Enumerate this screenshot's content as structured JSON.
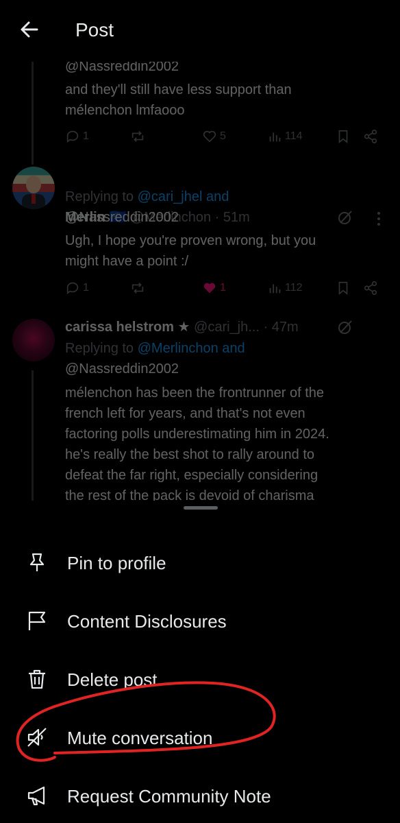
{
  "header": {
    "title": "Post"
  },
  "tweets": [
    {
      "replying_handle_cont": "@Nassreddin2002",
      "text_lines": [
        "and they'll still have less support than",
        "mélenchon lmfaooo"
      ],
      "replies": "1",
      "likes": "5",
      "views": "114"
    },
    {
      "name": "Merlin",
      "flag": "🇪🇺",
      "handle": "@Merlinchon",
      "time": "· 51m",
      "replying_prefix": "Replying to",
      "replying_handles": "@cari_jhel and",
      "replying_handles_2": "@Nassreddin2002",
      "text_lines": [
        "Ugh, I hope you're proven wrong, but you",
        "might have a point :/"
      ],
      "replies": "1",
      "likes": "1",
      "views": "112"
    },
    {
      "name": "carissa helstrom ★",
      "handle": "@cari_jh...",
      "time": "· 47m",
      "replying_prefix": "Replying to",
      "replying_handles": "@Merlinchon and",
      "replying_handles_2": "@Nassreddin2002",
      "text_lines": [
        "mélenchon has been the frontrunner of the",
        "french left for years, and that's not even",
        "factoring polls underestimating him in 2024.",
        "he's really the best shot to rally around to",
        "defeat the far right, especially considering",
        "the rest of the pack is devoid of charisma"
      ]
    }
  ],
  "menu": {
    "items": [
      {
        "label": "Pin to profile",
        "icon": "pin-icon"
      },
      {
        "label": "Content Disclosures",
        "icon": "flag-icon"
      },
      {
        "label": "Delete post",
        "icon": "trash-icon"
      },
      {
        "label": "Mute conversation",
        "icon": "mute-icon"
      },
      {
        "label": "Request Community Note",
        "icon": "megaphone-icon"
      }
    ]
  },
  "colors": {
    "background": "#000000",
    "text": "#e7e9ea",
    "muted": "#71767b",
    "link": "#1d9bf0",
    "like": "#f91880",
    "annotation": "#e02424"
  }
}
